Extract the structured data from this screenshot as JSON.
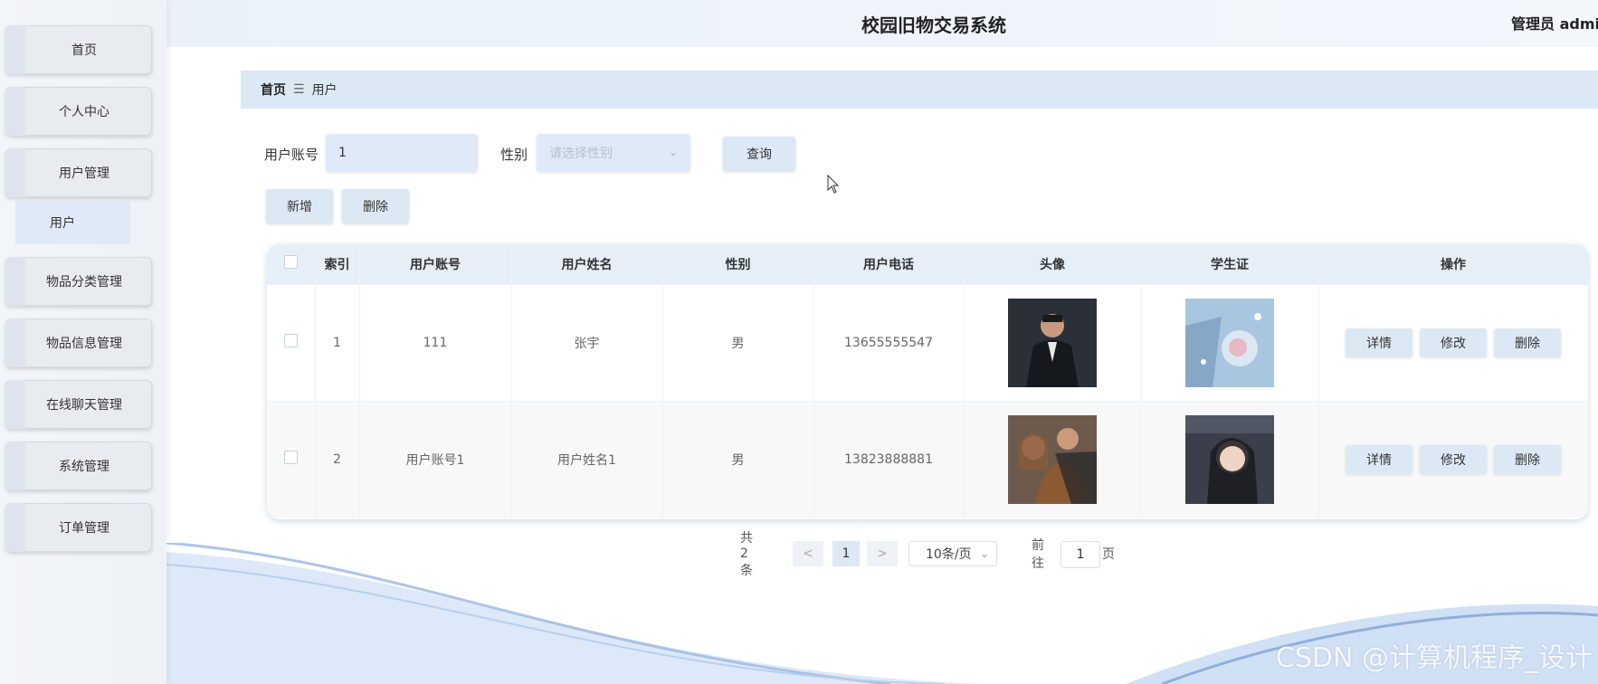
{
  "app": {
    "title": "校园旧物交易系统",
    "user": "管理员 admin"
  },
  "sidebar": {
    "items": [
      {
        "label": "首页"
      },
      {
        "label": "个人中心"
      },
      {
        "label": "用户管理"
      },
      {
        "label": "物品分类管理"
      },
      {
        "label": "物品信息管理"
      },
      {
        "label": "在线聊天管理"
      },
      {
        "label": "系统管理"
      },
      {
        "label": "订单管理"
      }
    ],
    "sub_item": "用户"
  },
  "breadcrumb": {
    "home": "首页",
    "separator": "☰",
    "current": "用户"
  },
  "search": {
    "account_label": "用户账号",
    "account_value": "1",
    "gender_label": "性别",
    "gender_placeholder": "请选择性别",
    "query_label": "查询"
  },
  "actions": {
    "add_label": "新增",
    "delete_label": "删除"
  },
  "table": {
    "headers": [
      "索引",
      "用户账号",
      "用户姓名",
      "性别",
      "用户电话",
      "头像",
      "学生证",
      "操作"
    ],
    "rows": [
      {
        "index": "1",
        "account": "111",
        "name": "张宇",
        "gender": "男",
        "phone": "13655555547"
      },
      {
        "index": "2",
        "account": "用户账号1",
        "name": "用户姓名1",
        "gender": "男",
        "phone": "13823888881"
      }
    ],
    "op_labels": {
      "detail": "详情",
      "edit": "修改",
      "delete": "删除"
    }
  },
  "pagination": {
    "total": "共 2 条",
    "prev": "<",
    "current": "1",
    "next": ">",
    "page_size": "10条/页",
    "goto_label": "前往",
    "goto_value": "1",
    "page_suffix": "页"
  },
  "watermark": "CSDN @计算机程序_设计",
  "colors": {
    "accent": "#dde8f5",
    "header_bg": "#e6eef8"
  }
}
